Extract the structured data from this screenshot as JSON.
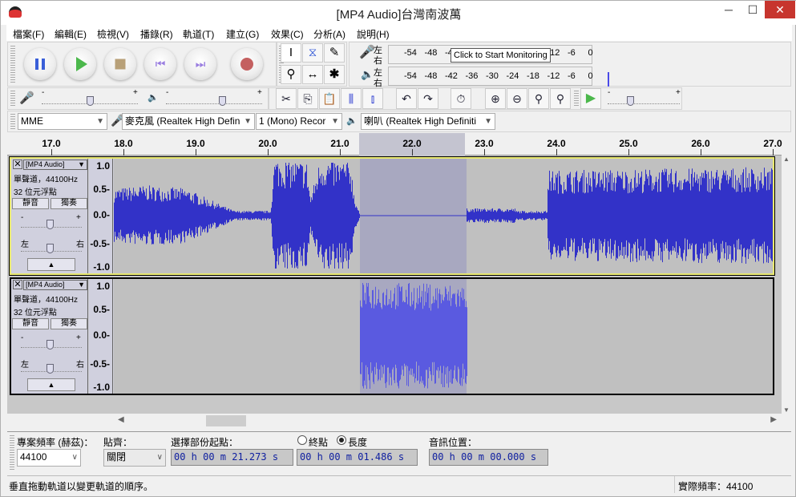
{
  "window": {
    "title": "[MP4 Audio]台灣南波萬",
    "minimize": "─",
    "maximize": "☐",
    "close": "✕"
  },
  "menu": [
    "檔案(F)",
    "編輯(E)",
    "檢視(V)",
    "播錄(R)",
    "軌道(T)",
    "建立(G)",
    "效果(C)",
    "分析(A)",
    "說明(H)"
  ],
  "transport": [
    "pause",
    "play",
    "stop",
    "skip-start",
    "skip-end",
    "record"
  ],
  "meters": {
    "rec_left": "左",
    "rec_right": "右",
    "play_left": "左",
    "play_right": "右",
    "ticks": [
      "-54",
      "-48",
      "-42",
      "-36",
      "-30",
      "-24",
      "-18",
      "-12",
      "-6",
      "0"
    ],
    "tooltip": "Click to Start Monitoring"
  },
  "slider_ends": {
    "minus": "-",
    "plus": "+"
  },
  "devices": {
    "host": "MME",
    "input": "麥克風 (Realtek High Defin",
    "channels": "1 (Mono) Recor",
    "output": "喇叭 (Realtek High Definiti"
  },
  "ruler": [
    "17.0",
    "18.0",
    "19.0",
    "20.0",
    "21.0",
    "22.0",
    "23.0",
    "24.0",
    "25.0",
    "26.0",
    "27.0"
  ],
  "tracks": [
    {
      "name": "[MP4 Audio]",
      "info1": "單聲道，44100Hz",
      "info2": "32 位元浮點",
      "mute": "靜音",
      "solo": "獨奏",
      "gain_minus": "-",
      "gain_plus": "+",
      "pan_left": "左",
      "pan_right": "右",
      "scale": [
        "1.0",
        "0.5-",
        "0.0-",
        "-0.5-",
        "-1.0"
      ],
      "selected": true
    },
    {
      "name": "[MP4 Audio]",
      "info1": "單聲道，44100Hz",
      "info2": "32 位元浮點",
      "mute": "靜音",
      "solo": "獨奏",
      "gain_minus": "-",
      "gain_plus": "+",
      "pan_left": "左",
      "pan_right": "右",
      "scale": [
        "1.0",
        "0.5-",
        "0.0-",
        "-0.5-",
        "-1.0"
      ],
      "selected": false
    }
  ],
  "colors": {
    "wave": "#3232c8",
    "wave_sel": "#5a5ae0",
    "selection_bg": "#a8a8c0",
    "track_selected_border": "#e8e870"
  },
  "bottom": {
    "rate_label": "專案頻率 (赫茲)：",
    "rate_value": "44100",
    "snap_label": "貼齊：",
    "snap_value": "關閉",
    "sel_start_label": "選擇部份起點：",
    "end_label": "終點",
    "length_label": "長度",
    "length_selected": true,
    "sel_start": "00 h 00 m 21.273 s",
    "sel_length": "00 h 00 m 01.486 s",
    "pos_label": "音訊位置：",
    "pos_value": "00 h 00 m 00.000 s"
  },
  "status": {
    "message": "垂直拖動軌道以變更軌道的順序。",
    "actual_rate": "實際頻率：44100"
  }
}
